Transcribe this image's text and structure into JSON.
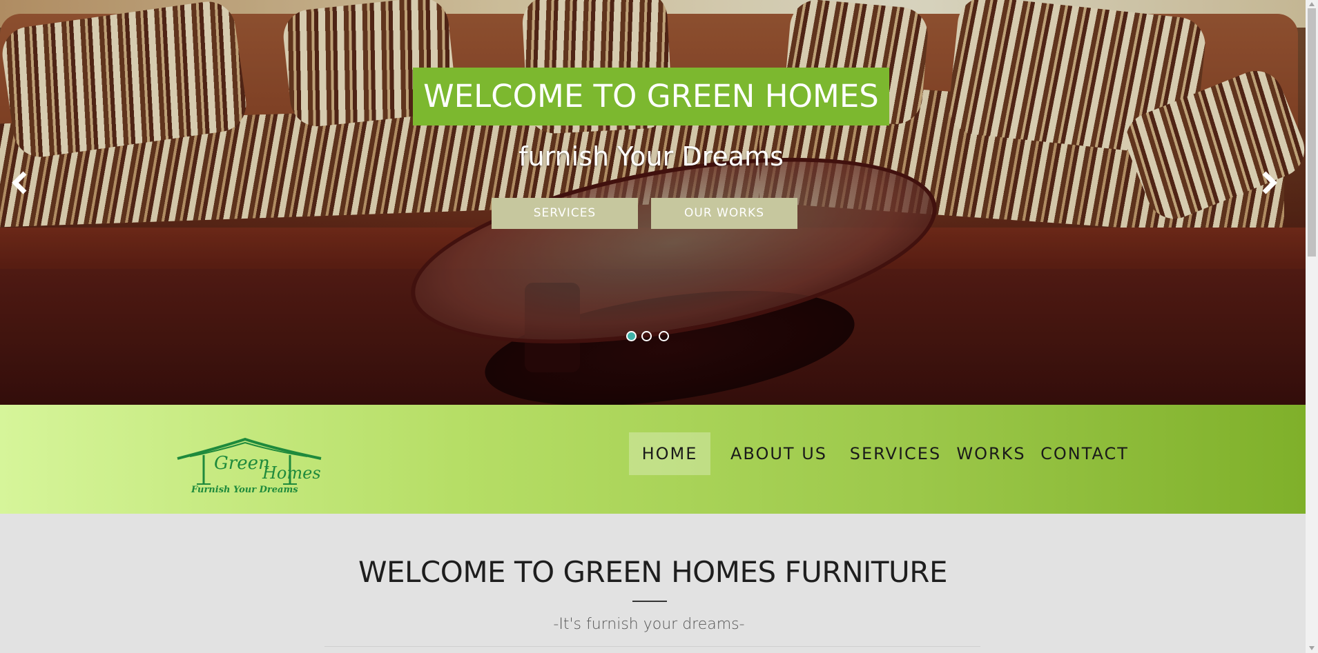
{
  "hero": {
    "title": "WELCOME TO GREEN HOMES",
    "subtitle": "furnish Your Dreams",
    "buttons": {
      "services": "SERVICES",
      "works": "OUR WORKS"
    },
    "slides_total": 3,
    "active_slide": 1,
    "icons": {
      "prev": "chevron-left-icon",
      "next": "chevron-right-icon"
    }
  },
  "logo": {
    "line1": "Green",
    "line2": "Homes",
    "tagline": "Furnish Your Dreams"
  },
  "nav": {
    "items": [
      {
        "label": "HOME",
        "active": true
      },
      {
        "label": "ABOUT US",
        "active": false
      },
      {
        "label": "SERVICES",
        "active": false
      },
      {
        "label": "WORKS",
        "active": false
      },
      {
        "label": "CONTACT",
        "active": false
      }
    ]
  },
  "main": {
    "title": "WELCOME TO GREEN HOMES FURNITURE",
    "tagline": "-It's furnish your dreams-"
  },
  "colors": {
    "accent_green": "#7cb82f",
    "button_khaki": "#c6c79e",
    "nav_gradient_start": "#d6f59a",
    "nav_gradient_end": "#7fb02a",
    "logo_green": "#1e8a3c",
    "dot_active": "#3fb2a8",
    "page_bg": "#e2e2e2"
  }
}
